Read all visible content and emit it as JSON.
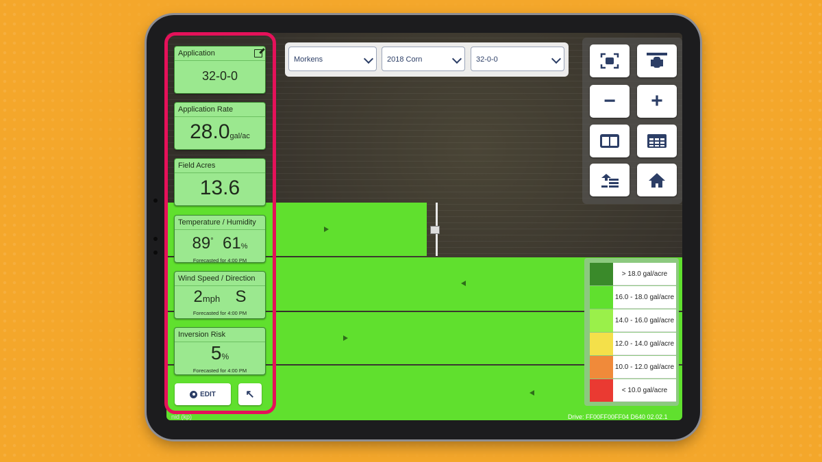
{
  "cards": {
    "application": {
      "title": "Application",
      "value": "32-0-0"
    },
    "rate": {
      "title": "Application Rate",
      "value": "28.0",
      "unit": "gal/ac"
    },
    "acres": {
      "title": "Field Acres",
      "value": "13.6"
    },
    "temp": {
      "title": "Temperature / Humidity",
      "temp": "89",
      "deg": "°",
      "humidity": "61",
      "pct": "%",
      "forecast": "Forecasted for 4:00 PM"
    },
    "wind": {
      "title": "Wind Speed / Direction",
      "speed": "2",
      "unit": "mph",
      "dir": "S",
      "forecast": "Forecasted for 4:00 PM"
    },
    "inversion": {
      "title": "Inversion Risk",
      "value": "5",
      "unit": "%",
      "forecast": "Forecasted for 4:00 PM"
    }
  },
  "buttons": {
    "edit": "EDIT",
    "expand": "↖"
  },
  "dropdowns": {
    "farm": "Morkens",
    "field": "2018 Corn",
    "product": "32-0-0"
  },
  "legend": [
    {
      "label": "> 18.0 gal/acre",
      "color": "#3a8a2a"
    },
    {
      "label": "16.0 - 18.0 gal/acre",
      "color": "#60e02e"
    },
    {
      "label": "14.0 - 16.0 gal/acre",
      "color": "#9af04a"
    },
    {
      "label": "12.0 - 14.0 gal/acre",
      "color": "#f4e04a"
    },
    {
      "label": "10.0 - 12.0 gal/acre",
      "color": "#f08a3a"
    },
    {
      "label": "< 10.0 gal/acre",
      "color": "#ea3a32"
    }
  ],
  "status": {
    "left": "nid (kp)",
    "right": "Drive: FF00FF00FF04 D640 02.02.1"
  },
  "colors": {
    "highlight": "#e5115a",
    "card": "#9be88f",
    "coverage": "#60e02e"
  }
}
